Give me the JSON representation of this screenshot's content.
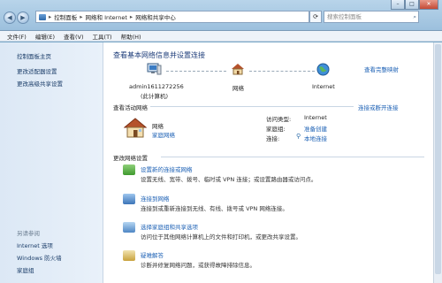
{
  "address": {
    "crumbs": [
      "控制面板",
      "网络和 Internet",
      "网络和共享中心"
    ],
    "search_placeholder": "搜索控制面板"
  },
  "menu": [
    "文件(F)",
    "编辑(E)",
    "查看(V)",
    "工具(T)",
    "帮助(H)"
  ],
  "sidebar": {
    "links": [
      "控制面板主页",
      "更改适配器设置",
      "更改高级共享设置"
    ],
    "see_also_header": "另请参阅",
    "see_also": [
      "Internet 选项",
      "Windows 防火墙",
      "家庭组"
    ]
  },
  "main": {
    "title": "查看基本网络信息并设置连接",
    "full_map": "查看完整映射",
    "map": {
      "computer": "admin1611272256",
      "computer_sub": "(此计算机)",
      "network": "网络",
      "internet": "Internet"
    },
    "active_header": "查看活动网络",
    "connect_disconnect": "连接或断开连接",
    "active": {
      "name": "网络",
      "type": "家庭网络",
      "access_label": "访问类型:",
      "access_value": "Internet",
      "homegroup_label": "家庭组:",
      "homegroup_value": "准备创建",
      "conn_label": "连接:",
      "conn_value": "本地连接"
    },
    "change_header": "更改网络设置",
    "tasks": [
      {
        "title": "设置新的连接或网络",
        "desc": "设置无线、宽带、拨号、临时或 VPN 连接；或设置路由器或访问点。"
      },
      {
        "title": "连接到网络",
        "desc": "连接到或重新连接到无线、有线、拨号或 VPN 网络连接。"
      },
      {
        "title": "选择家庭组和共享选项",
        "desc": "访问位于其他网络计算机上的文件和打印机，或更改共享设置。"
      },
      {
        "title": "疑难解答",
        "desc": "诊断并修复网络问题，或获得故障排除信息。"
      }
    ]
  }
}
